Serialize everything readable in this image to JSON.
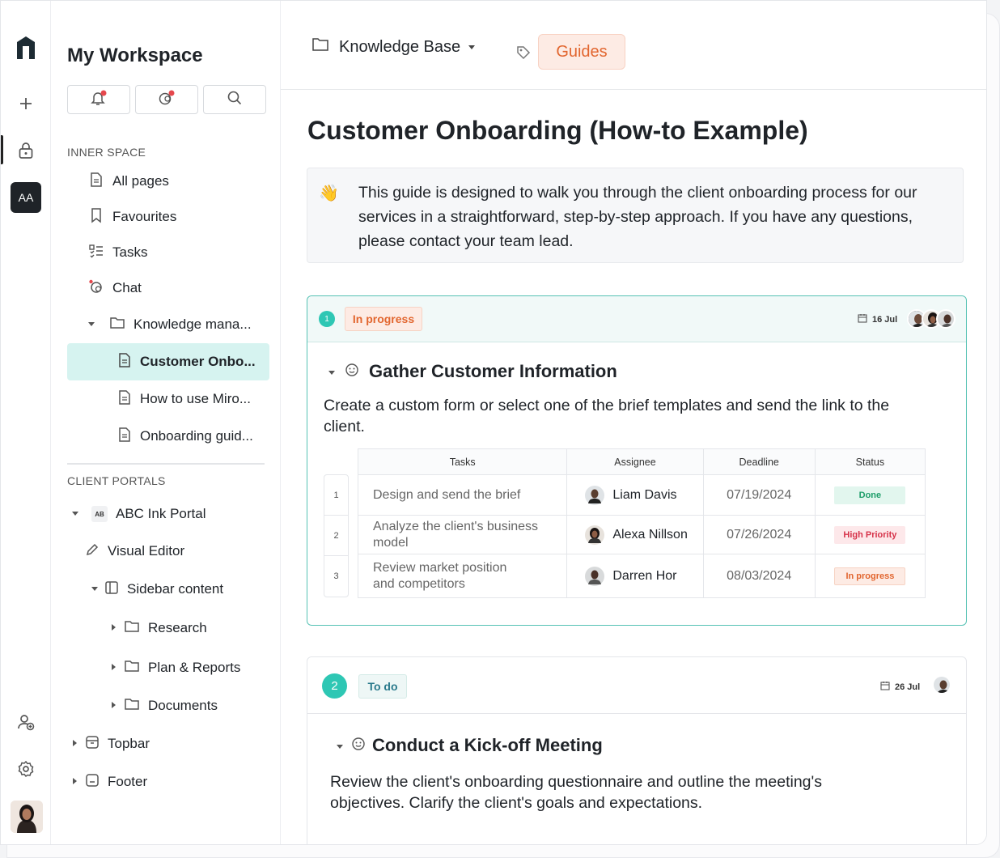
{
  "workspace": {
    "title": "My Workspace",
    "inner_space_label": "INNER SPACE",
    "client_portals_label": "CLIENT PORTALS",
    "nav": [
      "All pages",
      "Favourites",
      "Tasks",
      "Chat"
    ],
    "tree": [
      "Knowledge mana...",
      "Customer Onbo...",
      "How to use Miro...",
      "Onboarding guid..."
    ],
    "portal": {
      "name": "ABC Ink Portal",
      "badge": "AB",
      "items": [
        "Visual Editor",
        "Sidebar content",
        "Research",
        "Plan & Reports",
        "Documents",
        "Topbar",
        "Footer"
      ]
    },
    "user_initials": "AA"
  },
  "topbar": {
    "breadcrumb": "Knowledge Base",
    "tag": "Guides"
  },
  "page": {
    "title": "Customer Onboarding (How-to Example)",
    "callout_emoji": "👋",
    "callout_text": "This guide is designed to walk you through the client onboarding process for our services in a straightforward, step-by-step approach. If you have any questions, please contact your team lead."
  },
  "steps": [
    {
      "number": "1",
      "status": "In progress",
      "date": "16 Jul",
      "title": "Gather Customer Information",
      "description": "Create a custom form or select one of the brief templates and send the link to the client.",
      "table": {
        "headers": [
          "Tasks",
          "Assignee",
          "Deadline",
          "Status"
        ],
        "rows": [
          {
            "n": "1",
            "task": "Design and send the brief",
            "assignee": "Liam Davis",
            "deadline": "07/19/2024",
            "status": "Done"
          },
          {
            "n": "2",
            "task": "Analyze the client's business model",
            "assignee": "Alexa Nillson",
            "deadline": "07/26/2024",
            "status": "High Priority"
          },
          {
            "n": "3",
            "task": "Review market position and competitors",
            "assignee": "Darren Hor",
            "deadline": "08/03/2024",
            "status": "In progress"
          }
        ]
      }
    },
    {
      "number": "2",
      "status": "To do",
      "date": "26 Jul",
      "title": "Conduct a Kick-off Meeting",
      "description": "Review the client's onboarding questionnaire and outline the meeting's objectives. Clarify the client's goals and expectations."
    }
  ],
  "colors": {
    "accent": "#2ec7b4",
    "selected_bg": "#d6f3f0",
    "tag_orange": "#e2662f",
    "done_green": "#1e9e6a",
    "high_priority_red": "#d6334a"
  },
  "icons": [
    "logo-icon",
    "plus-icon",
    "lock-icon",
    "add-user-icon",
    "settings-icon",
    "bell-icon",
    "chat-icon",
    "search-icon",
    "file-icon",
    "bookmark-icon",
    "tasks-icon",
    "folder-icon",
    "pencil-icon",
    "sidebar-icon",
    "topbar-icon",
    "footer-icon",
    "tag-icon",
    "calendar-icon",
    "smile-icon",
    "caret-icon"
  ]
}
